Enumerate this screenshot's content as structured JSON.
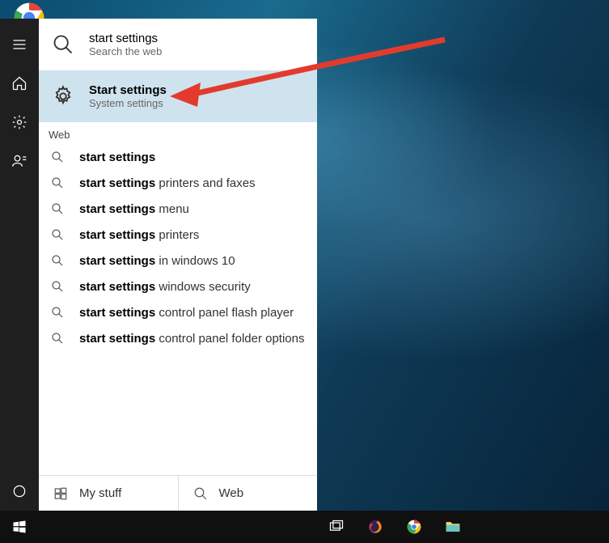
{
  "desktop": {
    "icon_name": "Google Chrome"
  },
  "search": {
    "top_result": {
      "title": "start settings",
      "subtitle": "Search the web"
    },
    "best_match": {
      "title": "Start settings",
      "subtitle": "System settings"
    },
    "web_section_label": "Web",
    "web_suggestions": [
      {
        "bold": "start settings",
        "rest": ""
      },
      {
        "bold": "start settings",
        "rest": " printers and faxes"
      },
      {
        "bold": "start settings",
        "rest": " menu"
      },
      {
        "bold": "start settings",
        "rest": " printers"
      },
      {
        "bold": "start settings",
        "rest": " in windows 10"
      },
      {
        "bold": "start settings",
        "rest": " windows security"
      },
      {
        "bold": "start settings",
        "rest": " control panel flash player"
      },
      {
        "bold": "start settings",
        "rest": " control panel folder options"
      }
    ],
    "footer": {
      "mystuff_label": "My stuff",
      "web_label": "Web"
    },
    "query": "Start settings"
  },
  "taskbar": {
    "apps": [
      {
        "name": "task-view"
      },
      {
        "name": "firefox"
      },
      {
        "name": "chrome"
      },
      {
        "name": "file-explorer"
      }
    ]
  }
}
